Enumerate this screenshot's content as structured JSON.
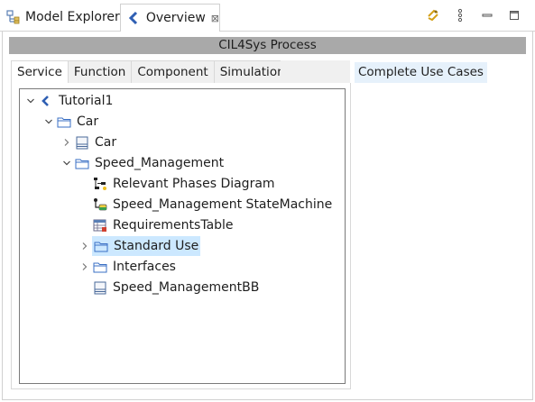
{
  "view_tabs": [
    {
      "label": "Model Explorer",
      "icon": "model-explorer-icon"
    },
    {
      "label": "Overview",
      "icon": "capella-logo-icon",
      "close": "⊠"
    }
  ],
  "view_toolbar": [
    {
      "icon": "sync-icon"
    },
    {
      "icon": "view-menu-icon"
    },
    {
      "icon": "minimize-icon"
    },
    {
      "icon": "maximize-icon"
    }
  ],
  "process": {
    "title": "CIL4Sys Process"
  },
  "tabs": [
    {
      "label": "Service",
      "selected": true
    },
    {
      "label": "Function"
    },
    {
      "label": "Component"
    },
    {
      "label": "Simulation"
    }
  ],
  "side_panel": {
    "link": "Complete Use Cases"
  },
  "tree": [
    {
      "label": "Tutorial1",
      "icon": "project-icon",
      "expanded": true
    },
    {
      "label": "Car",
      "icon": "folder-icon",
      "expanded": true
    },
    {
      "label": "Car",
      "icon": "block-icon",
      "expanded": false
    },
    {
      "label": "Speed_Management",
      "icon": "folder-icon",
      "expanded": true
    },
    {
      "label": "Relevant Phases Diagram",
      "icon": "diagram-icon"
    },
    {
      "label": "Speed_Management StateMachine",
      "icon": "statemachine-icon"
    },
    {
      "label": "RequirementsTable",
      "icon": "table-icon"
    },
    {
      "label": "Standard Use",
      "icon": "folder-icon",
      "expanded": false,
      "selected": true
    },
    {
      "label": "Interfaces",
      "icon": "folder-icon",
      "expanded": false
    },
    {
      "label": "Speed_ManagementBB",
      "icon": "block-icon"
    }
  ],
  "colors": {
    "header_bg": "#a9a9a9",
    "selection": "#cce8ff",
    "link_bg": "#e6f1fb",
    "accent_blue": "#3a6fc4"
  }
}
